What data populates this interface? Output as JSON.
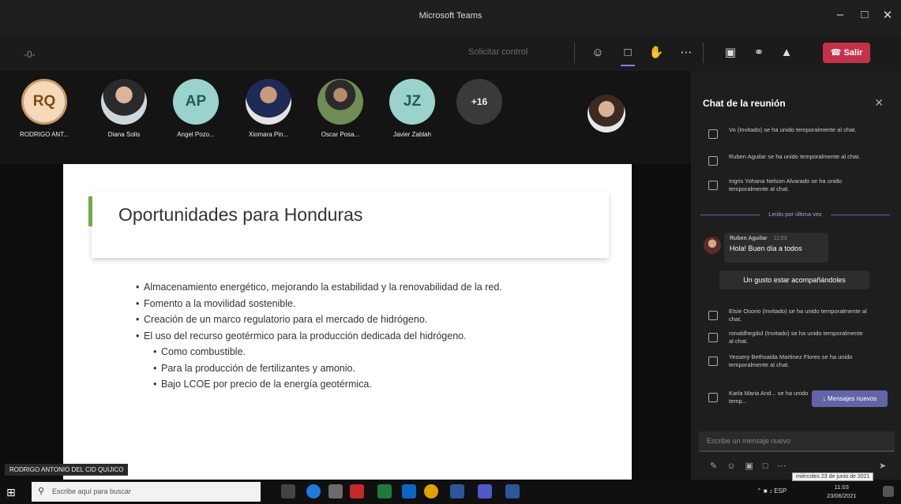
{
  "window": {
    "title": "Microsoft Teams",
    "minimize": "–",
    "maximize": "□",
    "close": "✕"
  },
  "toolbar": {
    "dash": "-0-",
    "request_control": "Solicitar control",
    "leave_label": "Salir"
  },
  "participants": [
    {
      "initials": "RQ",
      "name": "RODRIGO ANT..."
    },
    {
      "initials": "",
      "name": "Diana Solis"
    },
    {
      "initials": "AP",
      "name": "Angel Pozo..."
    },
    {
      "initials": "",
      "name": "Xiomara Pin..."
    },
    {
      "initials": "",
      "name": "Oscar Posa..."
    },
    {
      "initials": "JZ",
      "name": "Javier Zablah"
    },
    {
      "initials": "+16",
      "name": ""
    }
  ],
  "slide": {
    "title": "Oportunidades para Honduras",
    "bullets": [
      "Almacenamiento energético, mejorando la estabilidad y la renovabilidad de la red.",
      "Fomento a la movilidad sostenible.",
      "Creación de un marco regulatorio para el mercado de hidrógeno.",
      "El uso del recurso geotérmico para la producción dedicada del hidrógeno."
    ],
    "sub_bullets": [
      "Como combustible.",
      "Para la producción de fertilizantes y amonio.",
      "Bajo LCOE por precio de la energía geotérmica."
    ]
  },
  "presenter_name": "RODRIGO ANTONIO DEL CID QUIJICO",
  "chat": {
    "title": "Chat de la reunión",
    "system_messages_top": [
      "Vo (Invitado) se ha unido temporalmente al chat.",
      "Ruben Aguilar se ha unido temporalmente al chat.",
      "Ingris Yohana Nelson Alvarado se ha unido temporalmente al chat."
    ],
    "read_marker": "Leído por última vez",
    "message": {
      "author": "Ruben Aguilar",
      "time": "11:03",
      "text": "Hola! Buen día a todos",
      "followup": "Un gusto estar acompañándoles"
    },
    "system_messages_bottom": [
      "Elsie Osorio (Invitado) se ha unido temporalmente al chat.",
      "ronaldhegdul (Invitado) se ha unido temporalmente al chat.",
      "Yessery Bethsaida Martinez Flores se ha unido temporalmente al chat.",
      "Karla Maria And... se ha unido temp..."
    ],
    "new_messages": "Mensajes nuevos",
    "compose_placeholder": "Escribe un mensaje nuevo"
  },
  "taskbar": {
    "search_placeholder": "Escribe aquí para buscar",
    "tray_lang": "ESP",
    "clock_time": "11:03",
    "clock_date": "23/06/2021",
    "tooltip": "miércoles 23 de junio de 2021"
  }
}
